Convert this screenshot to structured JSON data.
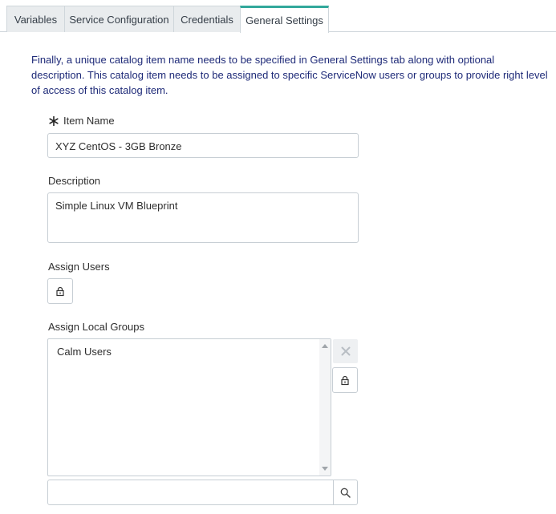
{
  "tabs": [
    {
      "label": "Variables",
      "active": false
    },
    {
      "label": "Service Configuration",
      "active": false
    },
    {
      "label": "Credentials",
      "active": false
    },
    {
      "label": "General Settings",
      "active": true
    }
  ],
  "intro": "Finally, a unique catalog item name needs to be specified in General Settings tab along with optional description. This catalog item needs to be assigned to specific ServiceNow users or groups to provide right level of access of this catalog item.",
  "form": {
    "item_name_label": "Item Name",
    "item_name_value": "XYZ CentOS - 3GB Bronze",
    "description_label": "Description",
    "description_value": "Simple Linux VM Blueprint",
    "assign_users_label": "Assign Users",
    "assign_groups_label": "Assign Local Groups",
    "groups": [
      "Calm Users"
    ],
    "group_search_value": ""
  },
  "icons": {
    "required": "asterisk-icon",
    "lock": "lock-icon",
    "remove": "close-icon",
    "search": "search-icon"
  },
  "colors": {
    "intro_text": "#1e2a78",
    "active_tab_accent": "#32a89b"
  }
}
